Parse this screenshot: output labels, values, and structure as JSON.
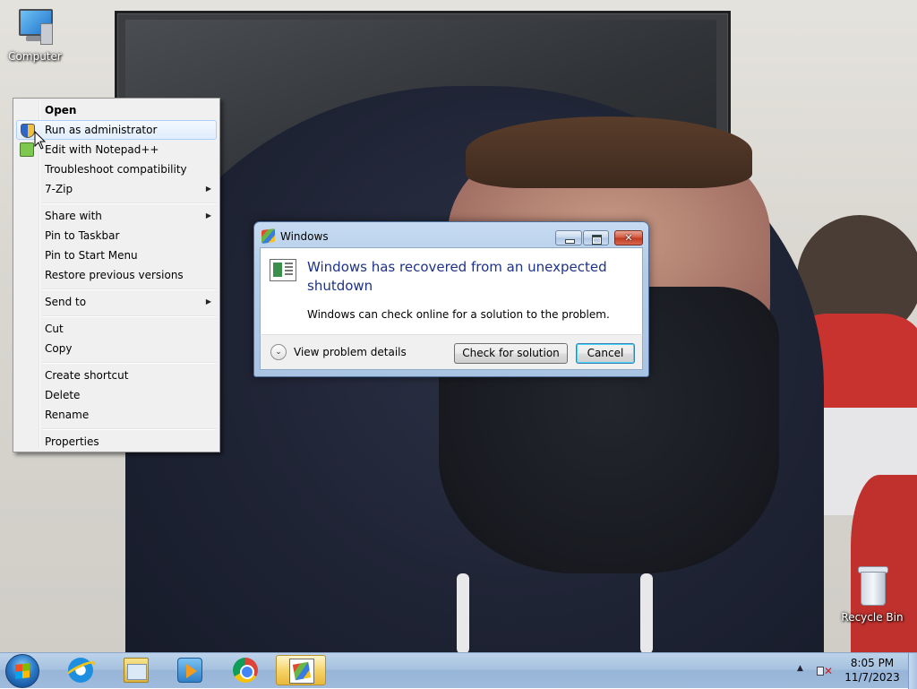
{
  "desktop": {
    "icons": [
      {
        "label": "Computer",
        "icon": "computer-icon"
      },
      {
        "label": "Recycle Bin",
        "icon": "recycle-bin-icon"
      }
    ]
  },
  "context_menu": {
    "items": [
      {
        "label": "Open",
        "bold": true
      },
      {
        "label": "Run as administrator",
        "icon": "uac-shield-icon",
        "highlighted": true
      },
      {
        "label": "Edit with Notepad++",
        "icon": "notepadpp-icon"
      },
      {
        "label": "Troubleshoot compatibility"
      },
      {
        "label": "7-Zip",
        "submenu": true
      },
      {
        "label": "Share with",
        "submenu": true
      },
      {
        "label": "Pin to Taskbar"
      },
      {
        "label": "Pin to Start Menu"
      },
      {
        "label": "Restore previous versions"
      },
      {
        "label": "Send to",
        "submenu": true
      },
      {
        "label": "Cut"
      },
      {
        "label": "Copy"
      },
      {
        "label": "Create shortcut"
      },
      {
        "label": "Delete"
      },
      {
        "label": "Rename"
      },
      {
        "label": "Properties"
      }
    ],
    "submenu_arrow": "▶"
  },
  "dialog": {
    "title": "Windows",
    "heading": "Windows has recovered from an unexpected shutdown",
    "message": "Windows can check online for a solution to the problem.",
    "details_label": "View problem details",
    "details_chevron": "⌄",
    "check_button": "Check for solution",
    "cancel_button": "Cancel",
    "close_glyph": "✕"
  },
  "taskbar": {
    "pinned": [
      {
        "name": "Internet Explorer",
        "icon": "internet-explorer-icon"
      },
      {
        "name": "Windows Explorer",
        "icon": "file-explorer-icon"
      },
      {
        "name": "Windows Media Player",
        "icon": "media-player-icon"
      },
      {
        "name": "Google Chrome",
        "icon": "chrome-icon"
      },
      {
        "name": "Windows",
        "icon": "windows-dialog-icon",
        "active": true
      }
    ],
    "tray_arrow": "▲",
    "volume_muted_glyph": "✕",
    "clock_time": "8:05 PM",
    "clock_date": "11/7/2023"
  },
  "colors": {
    "taskbar": "#a7c2e0",
    "dialog_heading": "#1e3287",
    "menu_highlight": "#aecff7"
  }
}
